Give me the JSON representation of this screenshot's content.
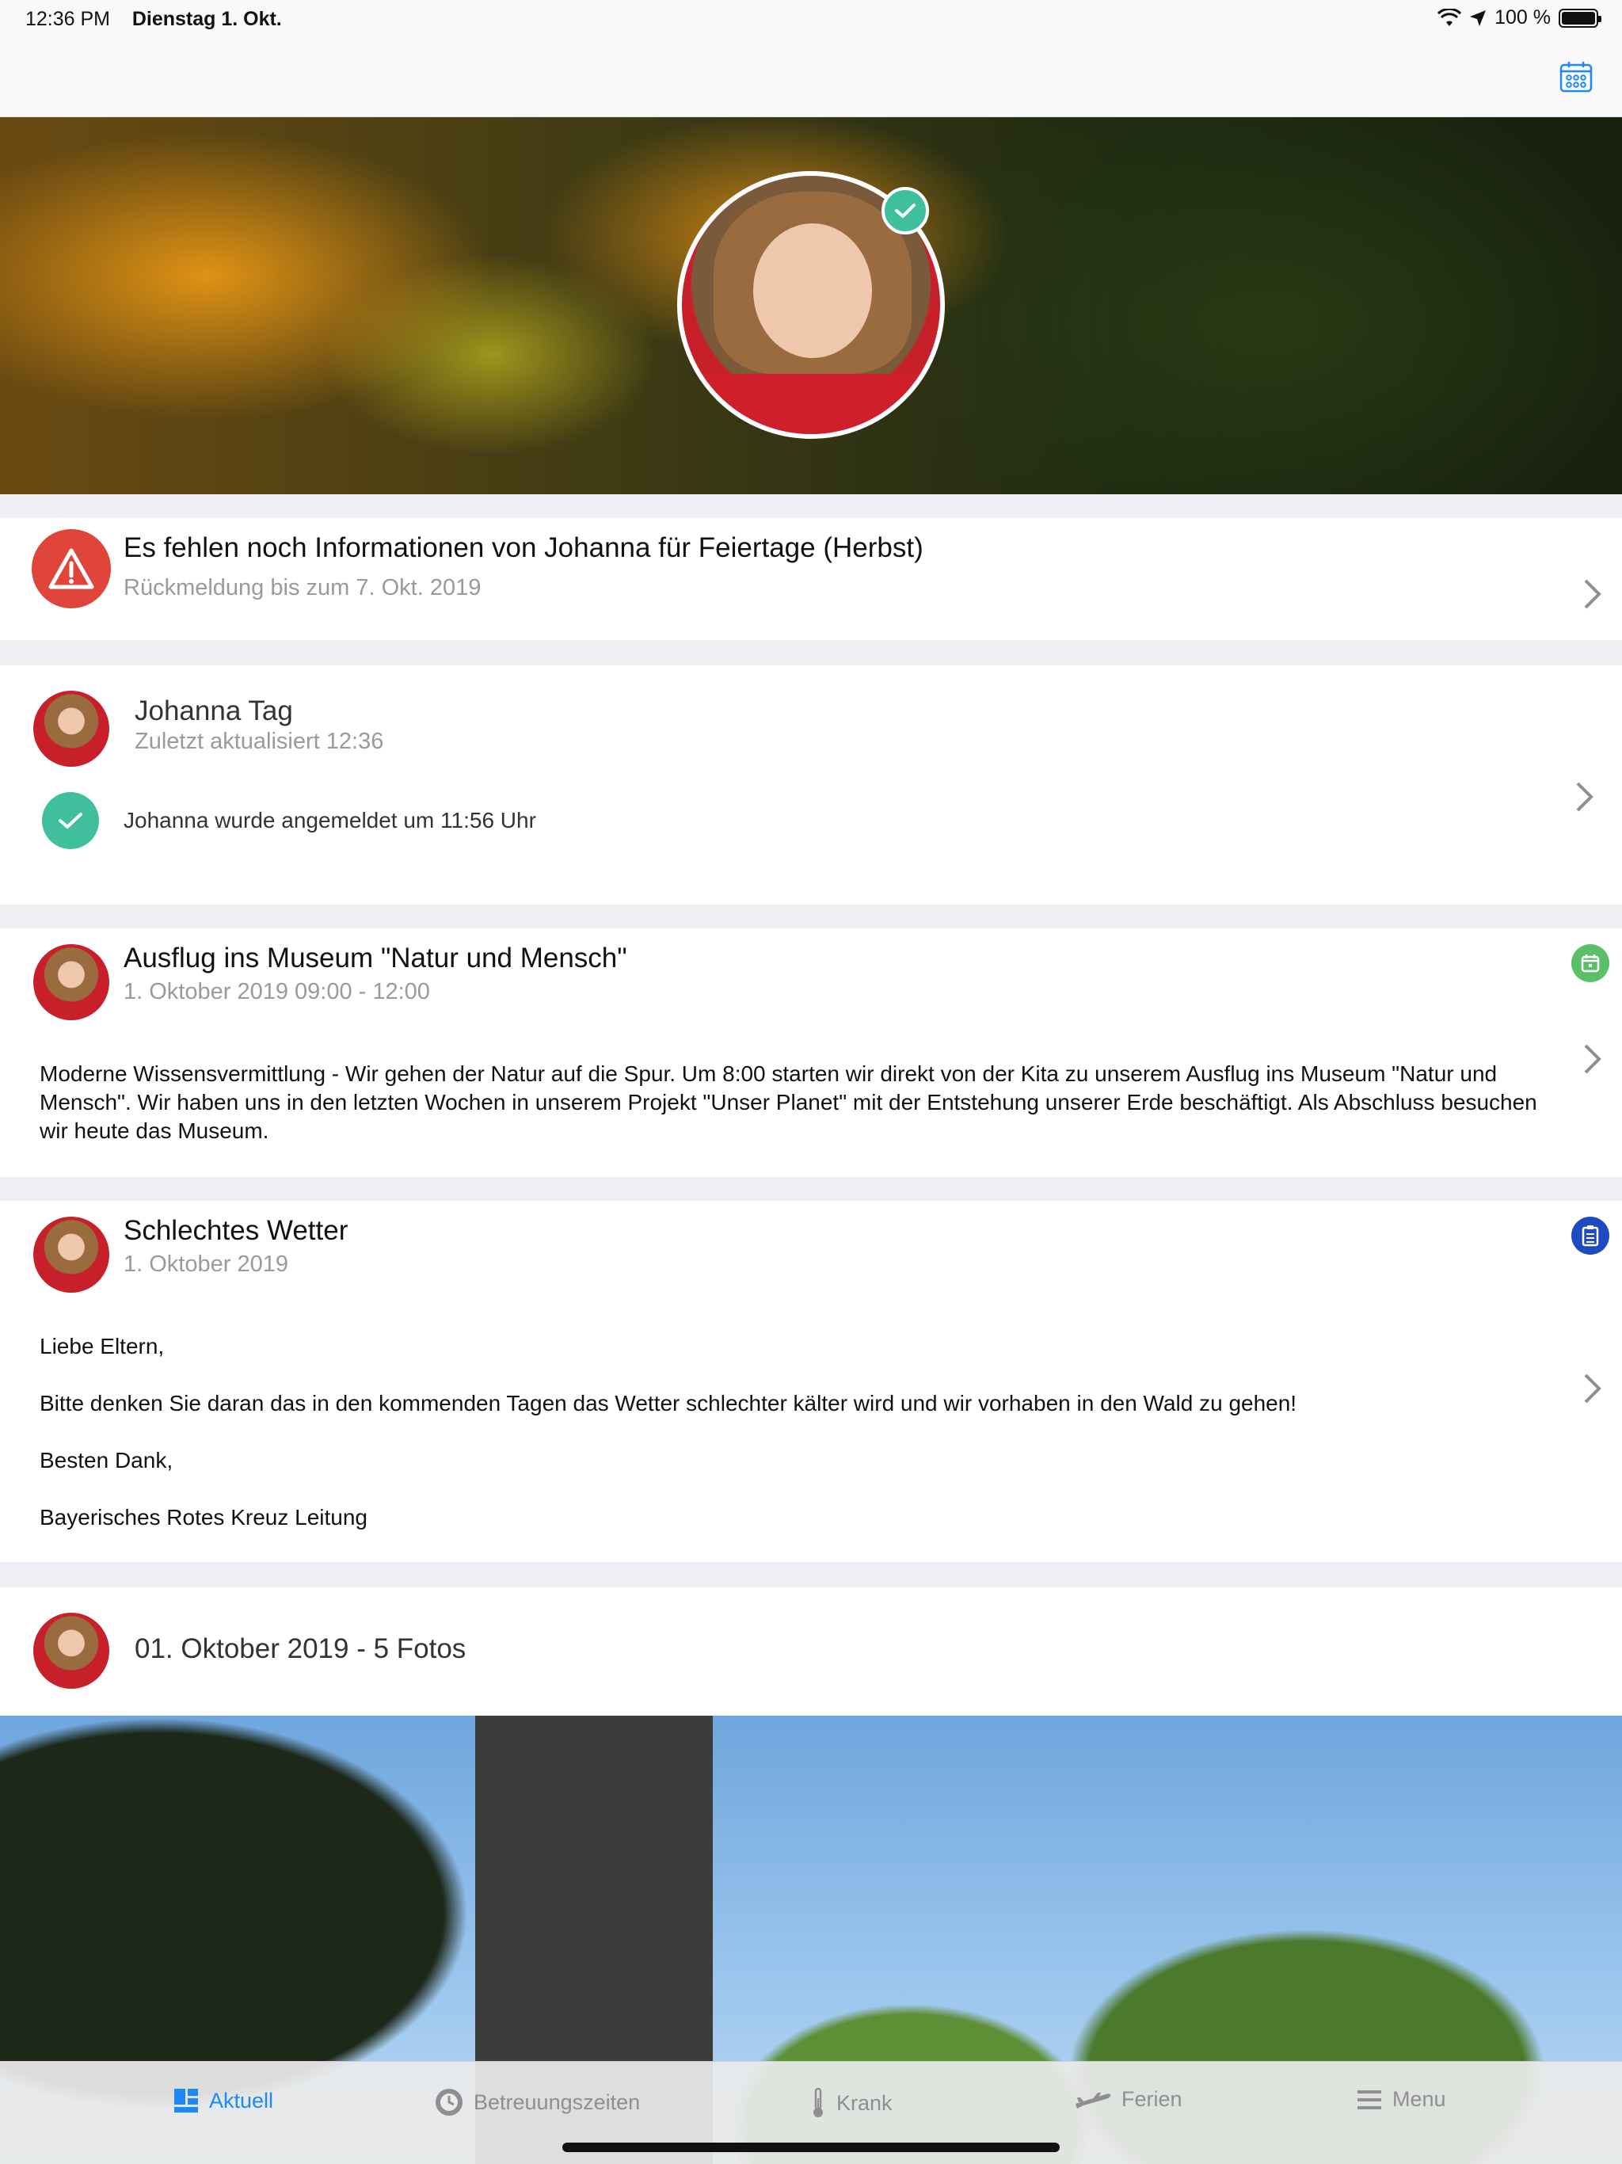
{
  "status_bar": {
    "time": "12:36 PM",
    "date": "Dienstag 1. Okt.",
    "battery": "100 %"
  },
  "alert": {
    "title": "Es fehlen noch Informationen von Johanna für Feiertage (Herbst)",
    "subtitle": "Rückmeldung bis zum 7. Okt. 2019"
  },
  "day": {
    "name": "Johanna Tag",
    "updated": "Zuletzt aktualisiert 12:36",
    "status": "Johanna wurde angemeldet um 11:56 Uhr"
  },
  "event": {
    "title": "Ausflug ins Museum \"Natur und Mensch\"",
    "time": "1. Oktober 2019 09:00 - 12:00",
    "body": "Moderne Wissensvermittlung - Wir gehen der Natur auf die Spur. Um 8:00 starten wir direkt von der Kita zu unserem Ausflug ins Museum \"Natur und Mensch\". Wir haben uns in den letzten Wochen in unserem Projekt \"Unser Planet\" mit der Entstehung unserer Erde beschäftigt. Als Abschluss besuchen wir heute das Museum.",
    "icon_color": "#5bbf6a"
  },
  "notice": {
    "title": "Schlechtes Wetter",
    "date": "1. Oktober 2019",
    "lines": [
      "Liebe Eltern,",
      "Bitte denken Sie daran das in den kommenden Tagen das Wetter schlechter kälter wird und wir vorhaben in den Wald zu gehen!",
      "Besten Dank,",
      "Bayerisches Rotes Kreuz Leitung"
    ],
    "icon_color": "#1d4bbd"
  },
  "photos": {
    "title": "01. Oktober 2019 - 5 Fotos"
  },
  "tabs": [
    {
      "label": "Aktuell",
      "icon": "dashboard-icon",
      "active": true
    },
    {
      "label": "Betreuungszeiten",
      "icon": "clock-icon",
      "active": false
    },
    {
      "label": "Krank",
      "icon": "thermometer-icon",
      "active": false
    },
    {
      "label": "Ferien",
      "icon": "airplane-icon",
      "active": false
    },
    {
      "label": "Menu",
      "icon": "hamburger-icon",
      "active": false
    }
  ],
  "colors": {
    "accent": "#1e88f7",
    "alert": "#e0453a",
    "success": "#3fbf9b"
  }
}
